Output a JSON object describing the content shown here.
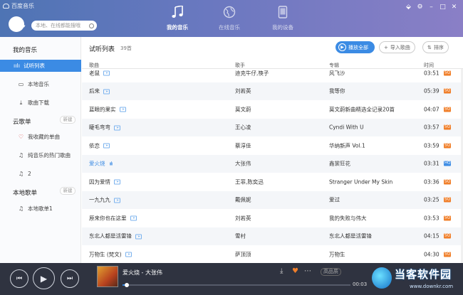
{
  "app": {
    "title": "百度音乐"
  },
  "search": {
    "placeholder": "本地、在线都能搜哦"
  },
  "nav": [
    {
      "label": "我的音乐",
      "icon": "music-note-icon",
      "active": true
    },
    {
      "label": "在线音乐",
      "icon": "globe-icon",
      "active": false
    },
    {
      "label": "我的设备",
      "icon": "phone-icon",
      "active": false
    }
  ],
  "sidebar": {
    "my_music_title": "我的音乐",
    "items": [
      {
        "label": "试听列表"
      },
      {
        "label": "本地音乐"
      },
      {
        "label": "歌曲下载"
      }
    ],
    "cloud_title": "云歌单",
    "cloud_new": "新建",
    "cloud_items": [
      {
        "label": "我收藏的单曲"
      },
      {
        "label": "纯音乐的热门歌曲"
      },
      {
        "label": "2"
      }
    ],
    "local_title": "本地歌单",
    "local_new": "新建",
    "local_items": [
      {
        "label": "本地歌单1"
      }
    ]
  },
  "main": {
    "list_title": "试听列表",
    "count": "39首",
    "play_all": "播放全部",
    "import": "导入歌曲",
    "sort": "排序",
    "columns": {
      "song": "歌曲",
      "singer": "歌手",
      "album": "专辑",
      "time": "时间"
    },
    "rows": [
      {
        "song": "老鼠",
        "mv": true,
        "singer": "迪克牛仔,筷子",
        "album": "风飞沙",
        "time": "03:51",
        "quality": "SQ"
      },
      {
        "song": "后来",
        "mv": true,
        "singer": "刘若英",
        "album": "我等你",
        "time": "05:39",
        "quality": "SQ"
      },
      {
        "song": "蓝眼的果实",
        "mv": true,
        "singer": "莫文蔚",
        "album": "莫文蔚新曲精选全记录20首",
        "time": "04:07",
        "quality": "SQ"
      },
      {
        "song": "睫毛弯弯",
        "mv": true,
        "singer": "王心凌",
        "album": "Cyndi With U",
        "time": "03:57",
        "quality": "SQ"
      },
      {
        "song": "依恋",
        "mv": true,
        "singer": "蔡淳佳",
        "album": "华纳新声 Vol.1",
        "time": "03:59",
        "quality": "SQ"
      },
      {
        "song": "爱火烧",
        "mv": false,
        "playing": true,
        "singer": "大张伟",
        "album": "鑫裳狂花",
        "time": "03:31",
        "quality": "HQ"
      },
      {
        "song": "因为爱情",
        "mv": true,
        "singer": "王菲,陈奕迅",
        "album": "Stranger Under My Skin",
        "time": "03:36",
        "quality": "SQ"
      },
      {
        "song": "一九九九",
        "mv": true,
        "singer": "戴佩妮",
        "album": "爱过",
        "time": "03:25",
        "quality": "SQ"
      },
      {
        "song": "原来你也在这里",
        "mv": true,
        "singer": "刘若英",
        "album": "我的失败与伟大",
        "time": "03:53",
        "quality": "SQ"
      },
      {
        "song": "东北人都是活雷锋",
        "mv": true,
        "singer": "雪村",
        "album": "东北人都是活雷锋",
        "time": "04:15",
        "quality": "SQ"
      },
      {
        "song": "万物生 (梵文)",
        "mv": true,
        "singer": "萨顶顶",
        "album": "万物生",
        "time": "04:30",
        "quality": "SQ"
      }
    ]
  },
  "player": {
    "now_playing": "爱火烧 - 大张伟",
    "time": "00:03",
    "quality": "高品质",
    "progress": 0.02
  },
  "brand": {
    "main": "当客软件园",
    "sub": "www.downkr.com"
  },
  "colors": {
    "accent": "#3b8be4",
    "sq": "#f07f2a",
    "hq": "#3b8be4"
  }
}
